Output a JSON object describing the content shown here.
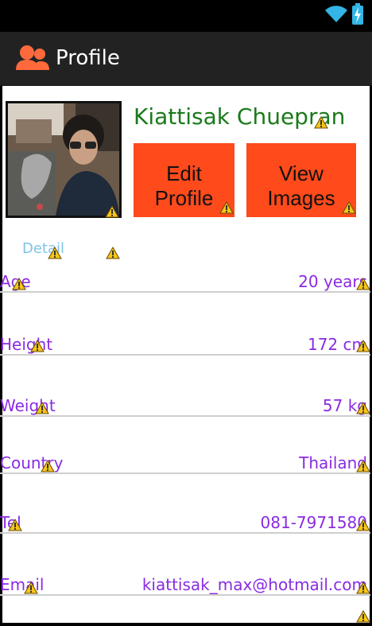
{
  "app": {
    "title": "Profile"
  },
  "profile": {
    "name": "Kiattisak Chuepran",
    "edit_button": "Edit\nProfile",
    "view_button": "View\nImages",
    "detail_label": "Detail"
  },
  "details": [
    {
      "label": "Age",
      "value": "20 years"
    },
    {
      "label": "Height",
      "value": "172 cm"
    },
    {
      "label": "Weight",
      "value": "57 kg"
    },
    {
      "label": "Country",
      "value": "Thailand"
    },
    {
      "label": "Tel",
      "value": "081-7971580"
    },
    {
      "label": "Email",
      "value": "kiattisak_max@hotmail.com"
    }
  ],
  "colors": {
    "action_bar": "#222222",
    "button": "#ff4a1c",
    "name": "#1a7a1a",
    "detail_text": "#8a2be2",
    "detail_tab": "#7fc4e6",
    "battery": "#33b5e5"
  }
}
